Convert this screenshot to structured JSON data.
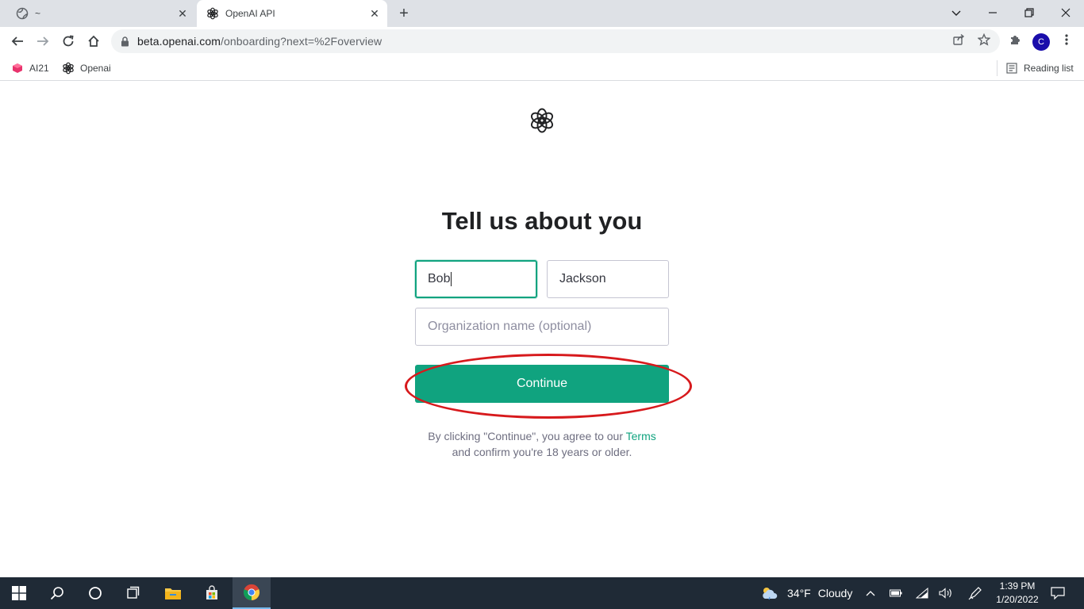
{
  "browser": {
    "tabs": [
      {
        "title": "~",
        "icon": "globe-icon"
      },
      {
        "title": "OpenAI API",
        "icon": "openai-logo-icon"
      }
    ],
    "url_host": "beta.openai.com",
    "url_path": "/onboarding?next=%2Foverview",
    "profile_initial": "C",
    "bookmarks": [
      {
        "label": "AI21",
        "icon": "ai21-icon"
      },
      {
        "label": "Openai",
        "icon": "openai-logo-icon"
      }
    ],
    "reading_list_label": "Reading list"
  },
  "page": {
    "heading": "Tell us about you",
    "first_name_value": "Bob",
    "last_name_value": "Jackson",
    "org_placeholder": "Organization name (optional)",
    "continue_label": "Continue",
    "legal_line1_prefix": "By clicking \"Continue\", you agree to our ",
    "legal_terms_link": "Terms",
    "legal_line2": "and confirm you're 18 years or older."
  },
  "taskbar": {
    "weather_temp": "34°F",
    "weather_desc": "Cloudy",
    "time": "1:39 PM",
    "date": "1/20/2022"
  },
  "colors": {
    "accent": "#10a37f",
    "annotation": "#d7191c",
    "taskbar": "#1f2a36"
  }
}
